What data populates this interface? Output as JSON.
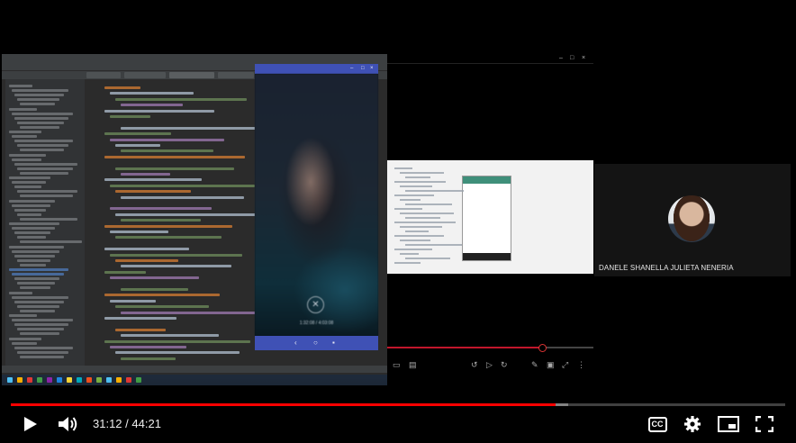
{
  "player": {
    "current_time": "31:12",
    "separator": " / ",
    "duration": "44:21",
    "played_fraction": 0.703,
    "buffered_fraction": 0.72,
    "cc_label": "CC"
  },
  "webcam": {
    "presenter_name": "DANELE SHANELLA JULIETA NENERIA"
  },
  "emulator": {
    "playback_time": "1:32:08 / 4:03:08",
    "play_symbol": "✕"
  },
  "mid_player": {
    "played_fraction": 0.75
  },
  "colors": {
    "youtube_red": "#ff0000",
    "emulator_header": "#3f51b5",
    "ide_background": "#2b2b2b"
  },
  "icons": {
    "play": "play-icon",
    "volume": "volume-icon",
    "captions": "closed-captions-icon",
    "settings": "gear-icon",
    "miniplayer": "miniplayer-icon",
    "fullscreen": "fullscreen-icon"
  }
}
